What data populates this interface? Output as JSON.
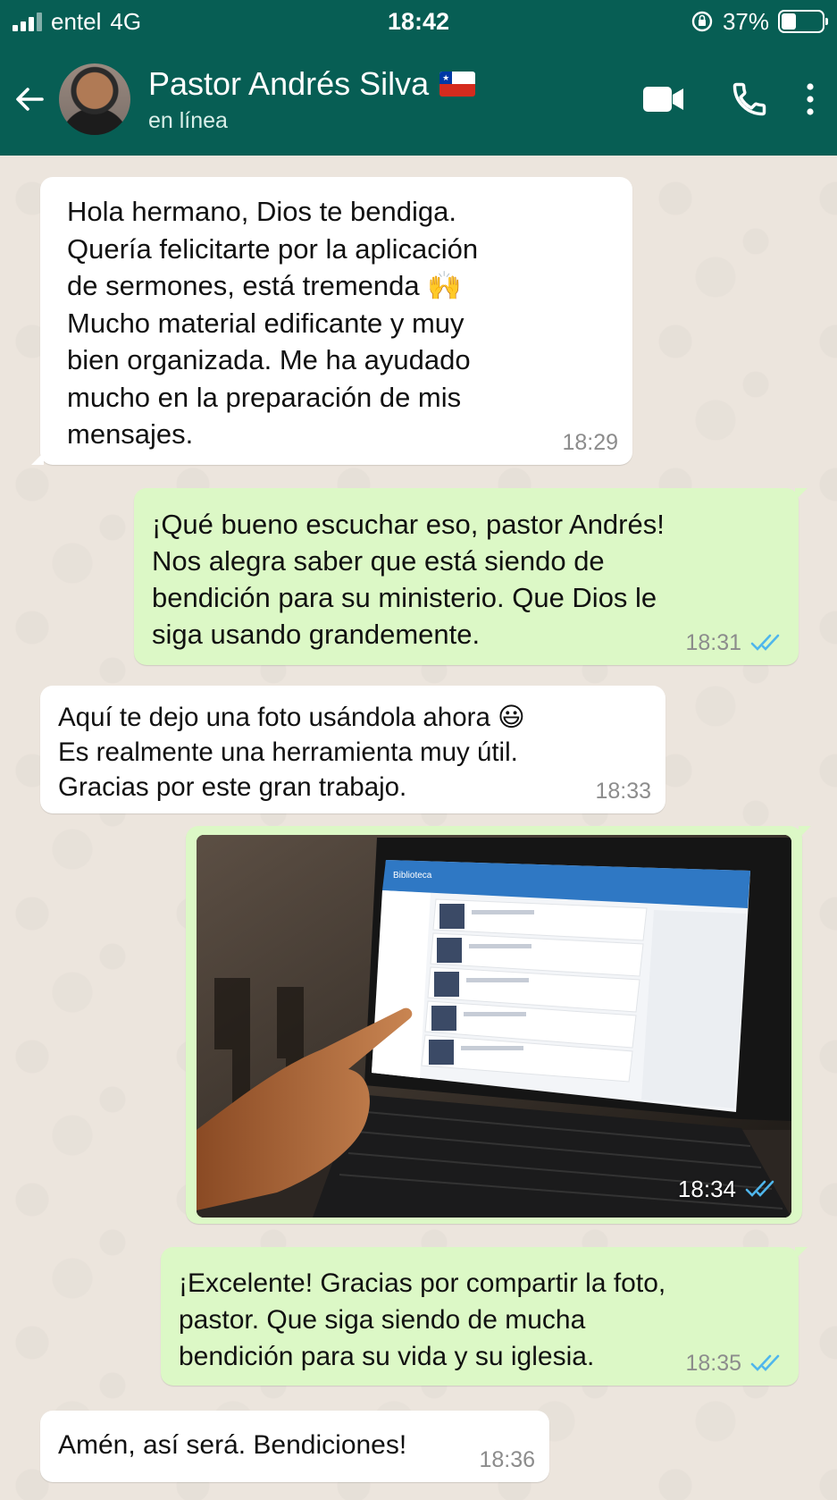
{
  "status_bar": {
    "carrier": "entel",
    "network": "4G",
    "time": "18:42",
    "battery": "37%",
    "battery_level": 0.37
  },
  "header": {
    "contact_name": "Pastor Andrés Silva",
    "status": "en línea"
  },
  "messages": [
    {
      "direction": "in",
      "text": "Hola hermano, Dios te bendiga.\nQuería felicitarte por la aplicación\nde sermones, está tremenda 🙌\nMucho material edificante y muy\nbien organizada. Me ha ayudado\nmucho en la preparación de mis\nmensajes.",
      "time": "18:29"
    },
    {
      "direction": "out",
      "text": "¡Qué bueno escuchar eso, pastor Andrés!\nNos alegra saber que está siendo de\nbendición para su ministerio. Que Dios le\nsiga usando grandemente.",
      "time": "18:31",
      "read": true
    },
    {
      "direction": "in",
      "text": "Aquí te dejo una foto usándola ahora 😃\nEs realmente una herramienta muy útil.\nGracias por este gran trabajo.",
      "time": "18:33"
    },
    {
      "direction": "out",
      "type": "image",
      "image_title": "Biblioteca",
      "time": "18:34",
      "read": true
    },
    {
      "direction": "out",
      "text": "¡Excelente! Gracias por compartir la foto,\npastor. Que siga siendo de mucha\nbendición para su vida y su iglesia.",
      "time": "18:35",
      "read": true
    },
    {
      "direction": "in",
      "text": "Amén, así será. Bendiciones!",
      "time": "18:36"
    }
  ],
  "colors": {
    "header_green": "#075e54",
    "outgoing_bubble": "#dcf8c6",
    "incoming_bubble": "#ffffff",
    "read_ticks": "#4fb6ec",
    "chat_background": "#ece5dd"
  },
  "icons": {
    "back": "arrow-left-icon",
    "video": "video-camera-icon",
    "call": "phone-icon",
    "menu": "more-vertical-icon",
    "read": "double-check-icon"
  }
}
